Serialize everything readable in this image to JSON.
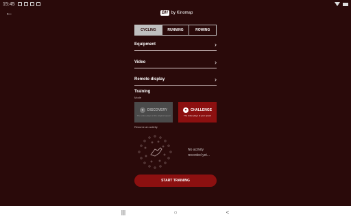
{
  "status": {
    "time": "15:45",
    "left_icons": [
      "notification-icon",
      "image-icon",
      "mail-icon",
      "android-icon"
    ]
  },
  "header": {
    "logo_badge": "BH",
    "logo_text": "by Kinomap"
  },
  "tabs": [
    {
      "label": "CYCLING",
      "active": true
    },
    {
      "label": "RUNNING",
      "active": false
    },
    {
      "label": "ROWING",
      "active": false
    }
  ],
  "settings": [
    {
      "label": "Equipment"
    },
    {
      "label": "Video"
    },
    {
      "label": "Remote display"
    }
  ],
  "training": {
    "title": "Training",
    "mode_label": "Mode",
    "discovery": {
      "title": "DISCOVERY",
      "desc": "The video plays at the original speed"
    },
    "challenge": {
      "title": "CHALLENGE",
      "desc": "The video plays at your speed"
    },
    "resume_label": "Resume an activity",
    "no_activity": "No activity recorded yet..."
  },
  "start_button": "START TRAINING",
  "colors": {
    "background": "#2a0a0a",
    "accent": "#8c1010",
    "tab_active": "#bfbfbf"
  }
}
